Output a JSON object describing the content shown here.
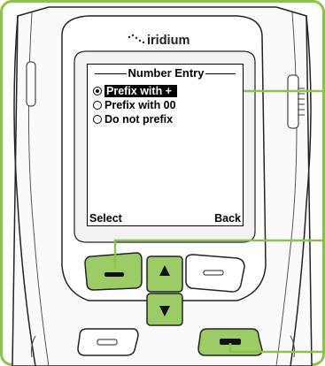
{
  "brand": {
    "logo_text": "iridium"
  },
  "screen": {
    "title": "Number Entry",
    "options": [
      {
        "label": "Prefix with +",
        "selected": true
      },
      {
        "label": "Prefix with 00",
        "selected": false
      },
      {
        "label": "Do not prefix",
        "selected": false
      }
    ],
    "soft_left": "Select",
    "soft_right": "Back"
  },
  "colors": {
    "highlight_green": "#9ccc65",
    "outline_green": "#8bc34a",
    "ink": "#000000"
  },
  "icons": [
    "scroll-up-arrow-icon",
    "up-arrow-icon",
    "down-arrow-icon",
    "softkey-left-icon",
    "softkey-right-icon",
    "send-call-icon",
    "end-call-icon"
  ]
}
